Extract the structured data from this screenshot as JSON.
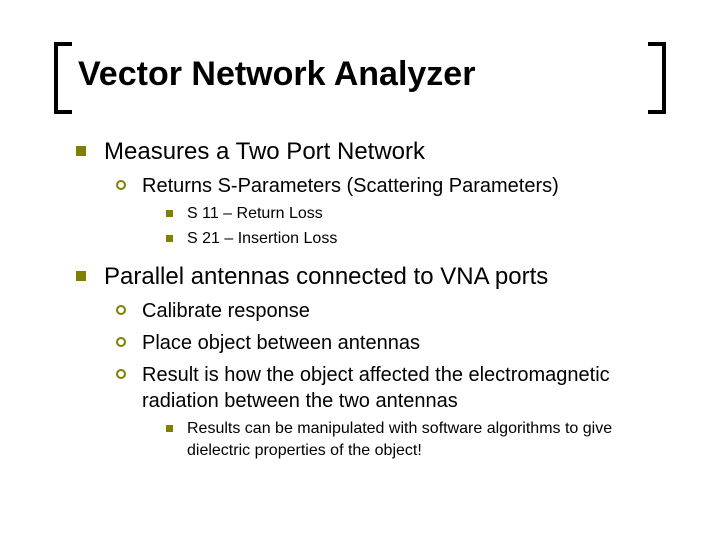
{
  "title": "Vector Network Analyzer",
  "items": [
    {
      "text": "Measures a Two Port Network",
      "sub": [
        {
          "text": "Returns S-Parameters (Scattering Parameters)",
          "sub": [
            {
              "text": "S 11 – Return Loss"
            },
            {
              "text": "S 21 – Insertion Loss"
            }
          ]
        }
      ]
    },
    {
      "text": "Parallel antennas connected to VNA ports",
      "sub": [
        {
          "text": "Calibrate response"
        },
        {
          "text": "Place object between antennas"
        },
        {
          "text": "Result is how the object affected the electromagnetic radiation between the two antennas",
          "sub": [
            {
              "text": "Results can be manipulated with software algorithms to give dielectric properties of the object!"
            }
          ]
        }
      ]
    }
  ]
}
